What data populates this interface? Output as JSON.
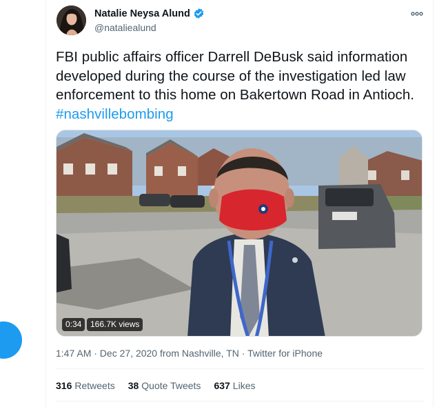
{
  "tweet": {
    "author_name": "Natalie Neysa Alund",
    "author_handle": "@nataliealund",
    "text_main": "FBI public affairs officer Darrell DeBusk said information developed during the course of the investigation led law enforcement to this home on Bakertown Road in Antioch. ",
    "hashtag": "#nashvillebombing",
    "video": {
      "duration": "0:34",
      "views": "166.7K views"
    },
    "timestamp": "1:47 AM · Dec 27, 2020",
    "location": "from Nashville, TN",
    "separator": "·",
    "source": "Twitter for iPhone",
    "stats": {
      "retweets_count": "316",
      "retweets_label": "Retweets",
      "quotes_count": "38",
      "quotes_label": "Quote Tweets",
      "likes_count": "637",
      "likes_label": "Likes"
    }
  },
  "colors": {
    "accent": "#1d9bf0",
    "secondary_text": "#536471",
    "primary_text": "#0f1419"
  },
  "icons": [
    "verified-badge-icon",
    "more-options-icon"
  ]
}
